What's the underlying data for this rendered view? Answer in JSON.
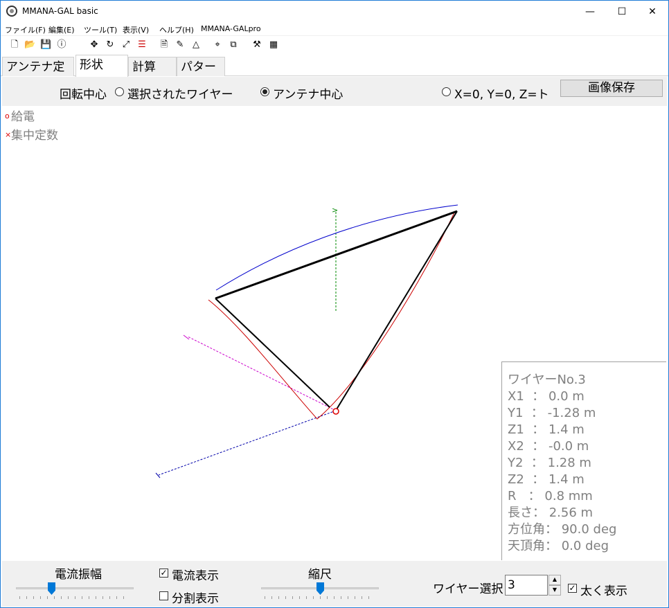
{
  "window": {
    "title": "MMANA-GAL basic"
  },
  "window_controls": {
    "minimize": "—",
    "maximize": "☐",
    "close": "✕"
  },
  "menu": [
    "ファイル(F)",
    "編集(E)",
    "ツール(T)",
    "表示(V)",
    "ヘルプ(H)",
    "MMANA-GALpro"
  ],
  "toolbar_icons": [
    "new-file-icon",
    "open-folder-icon",
    "save-icon",
    "info-icon",
    "move-icon",
    "rotate-icon",
    "resize-icon",
    "segments-icon",
    "document-icon",
    "pen-icon",
    "triangle-icon",
    "target-icon",
    "copy-icon",
    "tools-icon",
    "calculator-icon"
  ],
  "tabs": [
    "アンテナ定義",
    "形状",
    "計算",
    "パターン"
  ],
  "active_tab": "形状",
  "rotation": {
    "label": "回転中心",
    "options": [
      "選択されたワイヤー",
      "アンテナ中心",
      "X=0, Y=0, Z=ト"
    ],
    "selected": "アンテナ中心"
  },
  "save_button": "画像保存",
  "legend": {
    "feed": "給電",
    "feed_mark": "o",
    "load": "集中定数",
    "load_mark": "×"
  },
  "info": {
    "lines": [
      "ワイヤーNo.3",
      "X1  ： 0.0 m",
      "Y1  ： -1.28 m",
      "Z1  ： 1.4 m",
      "X2  ： -0.0 m",
      "Y2  ： 1.28 m",
      "Z2  ： 1.4 m",
      "R   ： 0.8 mm",
      "長さ： 2.56 m",
      "方位角： 90.0 deg",
      "天頂角： 0.0 deg"
    ]
  },
  "bottom": {
    "current_amplitude": "電流振幅",
    "show_current": "電流表示",
    "show_current_checked": true,
    "show_segments": "分割表示",
    "show_segments_checked": false,
    "scale": "縮尺",
    "wire_select": "ワイヤー選択",
    "wire_select_value": "3",
    "bold_display": "太く表示",
    "bold_display_checked": true,
    "current_amplitude_level": 0.3,
    "scale_level": 0.5
  },
  "colors": {
    "wire": "#000000",
    "current_red": "#cc0000",
    "current_blue": "#0000cc",
    "axis_x": "#cc00cc",
    "axis_y": "#0000aa",
    "axis_z": "#008800",
    "feed": "#dd0000"
  }
}
